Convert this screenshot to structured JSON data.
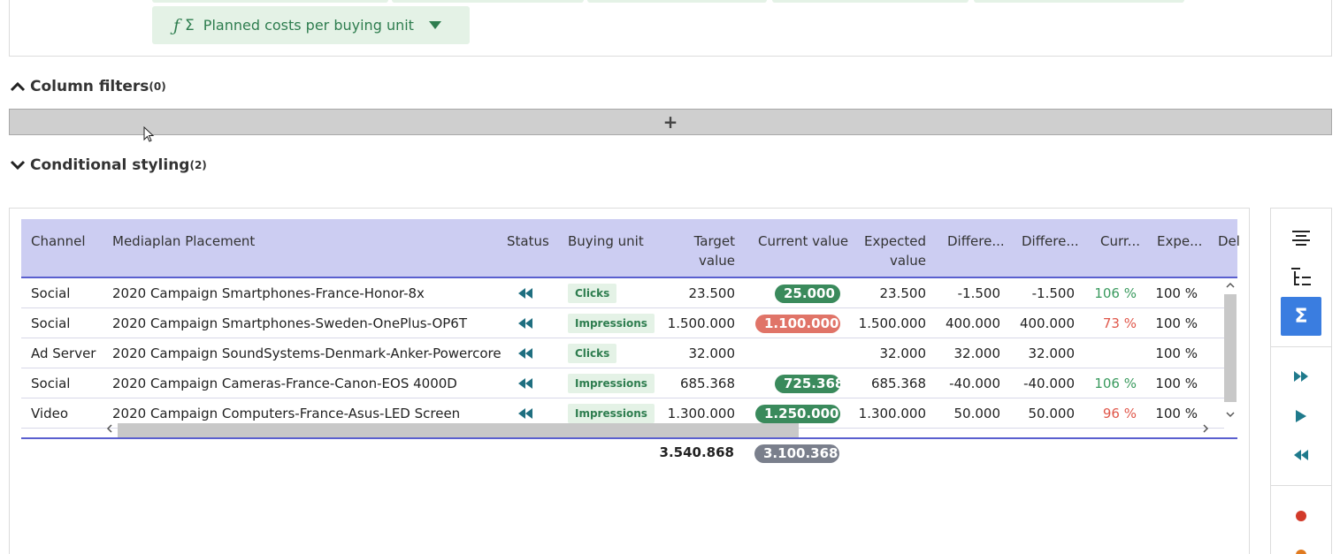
{
  "filters": {
    "active_chip_label": "Planned costs per buying unit",
    "active_chip_icon": "function-sigma-icon"
  },
  "column_filters": {
    "title": "Column filters",
    "count": "(0)",
    "add_label": "+"
  },
  "conditional_styling": {
    "title": "Conditional styling",
    "count": "(2)"
  },
  "table": {
    "headers": {
      "channel": "Channel",
      "placement": "Mediaplan Placement",
      "status": "Status",
      "buying_unit": "Buying unit",
      "target_value_1": "Target",
      "target_value_2": "value",
      "current_value": "Current value",
      "expected_value_1": "Expected",
      "expected_value_2": "value",
      "difference_1": "Differe...",
      "difference_2": "Differe...",
      "current_pct": "Curr...",
      "expected_pct": "Expe...",
      "del": "Del"
    },
    "rows": [
      {
        "channel": "Social",
        "placement": "2020 Campaign Smartphones-France-Honor-8x",
        "buying_unit": "Clicks",
        "target": "23.500",
        "current": "25.000",
        "current_color": "#3a8a5c",
        "expected": "23.500",
        "diff1": "-1.500",
        "diff2": "-1.500",
        "cur_pct": "106 %",
        "cur_pct_color": "#3a9a5e",
        "exp_pct": "100 %"
      },
      {
        "channel": "Social",
        "placement": "2020 Campaign Smartphones-Sweden-OnePlus-OP6T",
        "buying_unit": "Impressions",
        "target": "1.500.000",
        "current": "1.100.000",
        "current_color": "#e07468",
        "expected": "1.500.000",
        "diff1": "400.000",
        "diff2": "400.000",
        "cur_pct": "73 %",
        "cur_pct_color": "#e0574a",
        "exp_pct": "100 %"
      },
      {
        "channel": "Ad Server",
        "placement": "2020 Campaign SoundSystems-Denmark-Anker-Powercore",
        "buying_unit": "Clicks",
        "target": "32.000",
        "current": "",
        "current_color": "",
        "expected": "32.000",
        "diff1": "32.000",
        "diff2": "32.000",
        "cur_pct": "",
        "cur_pct_color": "",
        "exp_pct": "100 %"
      },
      {
        "channel": "Social",
        "placement": "2020 Campaign Cameras-France-Canon-EOS 4000D",
        "buying_unit": "Impressions",
        "target": "685.368",
        "current": "725.368",
        "current_color": "#3a8a5c",
        "expected": "685.368",
        "diff1": "-40.000",
        "diff2": "-40.000",
        "cur_pct": "106 %",
        "cur_pct_color": "#3a9a5e",
        "exp_pct": "100 %"
      },
      {
        "channel": "Video",
        "placement": "2020 Campaign Computers-France-Asus-LED Screen",
        "buying_unit": "Impressions",
        "target": "1.300.000",
        "current": "1.250.000",
        "current_color": "#3a8a5c",
        "expected": "1.300.000",
        "diff1": "50.000",
        "diff2": "50.000",
        "cur_pct": "96 %",
        "cur_pct_color": "#e0574a",
        "exp_pct": "100 %"
      }
    ],
    "totals": {
      "target": "3.540.868",
      "current": "3.100.368",
      "current_color": "#7a7f8c"
    }
  },
  "toolbar": {
    "buttons": [
      "align-center-icon",
      "tree-indent-icon",
      "sigma-icon",
      "fast-forward-icon",
      "play-icon",
      "rewind-icon"
    ],
    "accent": "#3a7de0",
    "icon_color": "#1f7a8c"
  }
}
